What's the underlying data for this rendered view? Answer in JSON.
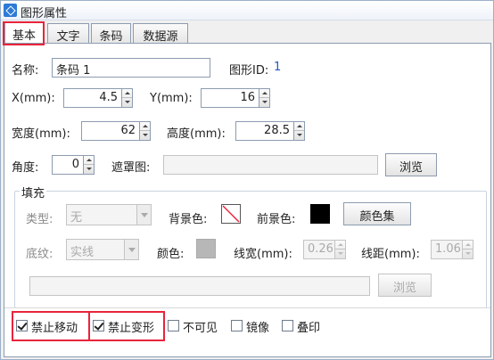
{
  "window": {
    "title": "图形属性"
  },
  "tabs": [
    {
      "label": "基本"
    },
    {
      "label": "文字"
    },
    {
      "label": "条码"
    },
    {
      "label": "数据源"
    }
  ],
  "basic": {
    "name_label": "名称:",
    "name_value": "条码 1",
    "id_label": "图形ID:",
    "id_value": "1",
    "x_label": "X(mm):",
    "x_value": "4.5",
    "y_label": "Y(mm):",
    "y_value": "16",
    "width_label": "宽度(mm):",
    "width_value": "62",
    "height_label": "高度(mm):",
    "height_value": "28.5",
    "angle_label": "角度:",
    "angle_value": "0",
    "mask_label": "遮罩图:",
    "mask_value": "",
    "browse_label": "浏览"
  },
  "fill": {
    "group_title": "填充",
    "type_label": "类型:",
    "type_value": "无",
    "bg_label": "背景色:",
    "fg_label": "前景色:",
    "color_set_label": "颜色集",
    "texture_label": "底纹:",
    "texture_value": "实线",
    "color_label": "颜色:",
    "line_width_label": "线宽(mm):",
    "line_width_value": "0.26",
    "line_spacing_label": "线距(mm):",
    "line_spacing_value": "1.06",
    "path_value": "",
    "browse_label": "浏览",
    "colors": {
      "foreground": "#000000",
      "texture_color": "#b7b7b7"
    }
  },
  "options": [
    {
      "label": "禁止移动",
      "checked": true
    },
    {
      "label": "禁止变形",
      "checked": true
    },
    {
      "label": "不可见",
      "checked": false
    },
    {
      "label": "镜像",
      "checked": false
    },
    {
      "label": "叠印",
      "checked": false
    }
  ],
  "colors": {
    "highlight": "#e8243c",
    "id_text": "#2256c4"
  }
}
